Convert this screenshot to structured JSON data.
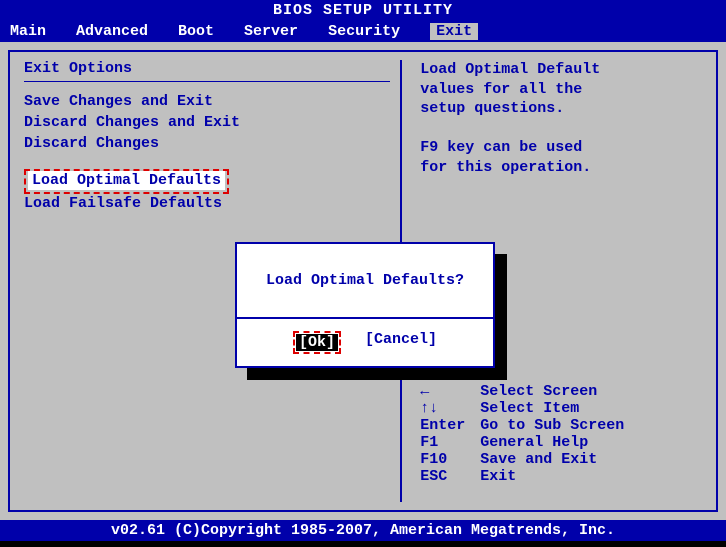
{
  "title": "BIOS SETUP UTILITY",
  "menu": {
    "items": [
      "Main",
      "Advanced",
      "Boot",
      "Server",
      "Security",
      "Exit"
    ],
    "selected": "Exit"
  },
  "left": {
    "section_title": "Exit Options",
    "options": [
      "Save Changes and Exit",
      "Discard Changes and Exit",
      "Discard Changes",
      "Load Optimal Defaults",
      "Load Failsafe Defaults"
    ],
    "selected_index": 3
  },
  "right": {
    "help_line1": "Load Optimal Default",
    "help_line2": "values for all the",
    "help_line3": "setup questions.",
    "help_line4": "F9 key can be used",
    "help_line5": "for this operation.",
    "keys": [
      {
        "key": "←",
        "desc": "Select Screen"
      },
      {
        "key": "↑↓",
        "desc": "Select Item"
      },
      {
        "key": "Enter",
        "desc": "Go to Sub Screen"
      },
      {
        "key": "F1",
        "desc": "General Help"
      },
      {
        "key": "F10",
        "desc": "Save and Exit"
      },
      {
        "key": "ESC",
        "desc": "Exit"
      }
    ]
  },
  "dialog": {
    "message": "Load Optimal Defaults?",
    "ok": "[Ok]",
    "cancel": "[Cancel]"
  },
  "footer": "v02.61 (C)Copyright 1985-2007, American Megatrends, Inc."
}
